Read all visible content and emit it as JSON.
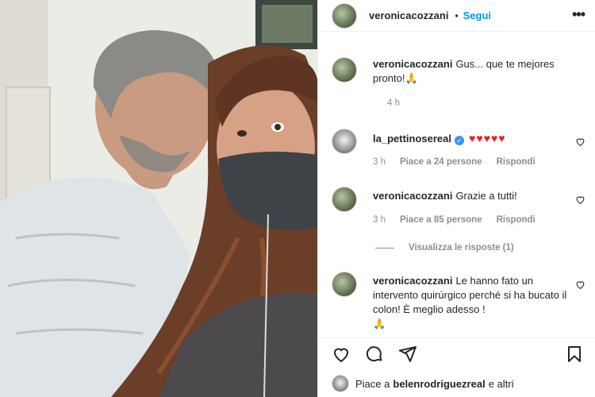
{
  "post": {
    "username": "veronicacozzani",
    "separator": "•",
    "follow_label": "Segui",
    "more_label": "•••"
  },
  "comments": [
    {
      "username": "veronicacozzani",
      "text": "Gus... que te mejores pronto!",
      "emoji": "🙏",
      "time": "4 h"
    },
    {
      "username": "la_pettinosereal",
      "verified": "✓",
      "hearts": "♥♥♥♥♥",
      "time": "3 h",
      "likes": "Piace a 24 persone",
      "reply": "Rispondi"
    },
    {
      "username": "veronicacozzani",
      "text": "Grazie a tutti!",
      "time": "3 h",
      "likes": "Piace a 85 persone",
      "reply": "Rispondi"
    },
    {
      "username": "veronicacozzani",
      "text": "Le hanno fato un intervento quirúrgico perché si ha bucato il colon! È meglio adesso !",
      "emoji": "🙏"
    }
  ],
  "view_replies": "Visualizza le risposte (1)",
  "likes_line": {
    "prefix": "Piace a",
    "user": "belenrodriguezreal",
    "suffix": "e altri"
  },
  "icons": {
    "like": "heart-icon",
    "comment": "comment-icon",
    "share": "share-icon",
    "save": "bookmark-icon"
  },
  "colors": {
    "link": "#0095f6",
    "text": "#262626",
    "muted": "#8e8e8e",
    "heart": "#ed1c24"
  }
}
